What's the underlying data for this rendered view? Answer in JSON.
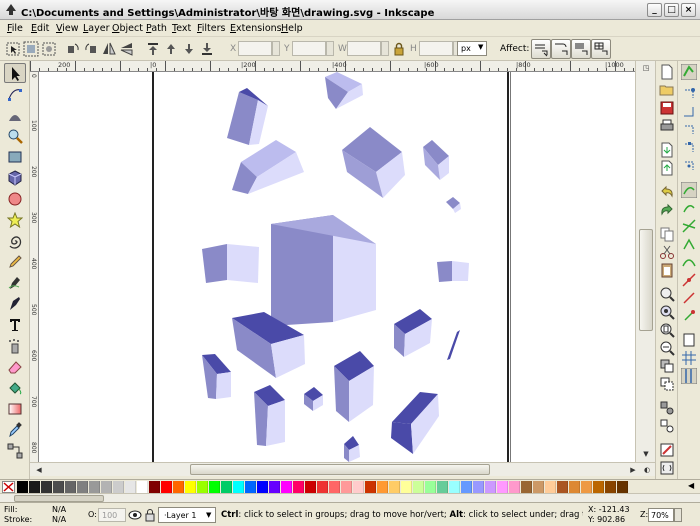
{
  "window": {
    "title": "C:\\Documents and Settings\\Administrator\\바탕 화면\\drawing.svg - Inkscape",
    "minimize": "_",
    "maximize": "□",
    "close": "×"
  },
  "menu": {
    "file": "File",
    "edit": "Edit",
    "view": "View",
    "layer": "Layer",
    "object": "Object",
    "path": "Path",
    "text": "Text",
    "filters": "Filters",
    "extensions": "Extensions",
    "help": "Help"
  },
  "toolbar": {
    "x_label": "X",
    "y_label": "Y",
    "w_label": "W",
    "h_label": "H",
    "x_value": "",
    "y_value": "",
    "w_value": "",
    "h_value": "",
    "unit": "px",
    "affect_label": "Affect:"
  },
  "ruler": {
    "h_labels": [
      "200",
      "|0",
      "|200",
      "|400",
      "|600",
      "|800",
      "|1000"
    ],
    "v_labels": [
      "0",
      "100",
      "200",
      "300",
      "400",
      "500",
      "600",
      "700",
      "800"
    ]
  },
  "status": {
    "fill_label": "Fill:",
    "fill_value": "N/A",
    "stroke_label": "Stroke:",
    "stroke_value": "N/A",
    "opacity_label": "O:",
    "opacity_value": "100",
    "layer": "·Layer 1",
    "message_bold1": "Ctrl",
    "message_1": ": click to select in groups; drag to move hor/vert; ",
    "message_bold2": "Alt",
    "message_2": ": click to select under; drag to move",
    "x_coord": "X: -121.43",
    "y_coord": "Y:  902.86",
    "zoom_label": "Z:",
    "zoom_value": "70%"
  },
  "colors": {
    "cube_top": "#4a4aa8",
    "cube_left": "#8a8ac8",
    "cube_right": "#dcdcfb",
    "cube_face": "#bcbcee"
  },
  "icons": {
    "tools": [
      "selector-arrow-icon",
      "node-editor-icon",
      "tweak-icon",
      "zoom-icon",
      "rectangle-icon",
      "3d-box-icon",
      "ellipse-icon",
      "star-icon",
      "spiral-icon",
      "pencil-icon",
      "pen-icon",
      "calligraphy-icon",
      "text-icon",
      "spray-icon",
      "eraser-icon",
      "paint-bucket-icon",
      "gradient-icon",
      "dropper-icon",
      "connector-icon"
    ]
  }
}
